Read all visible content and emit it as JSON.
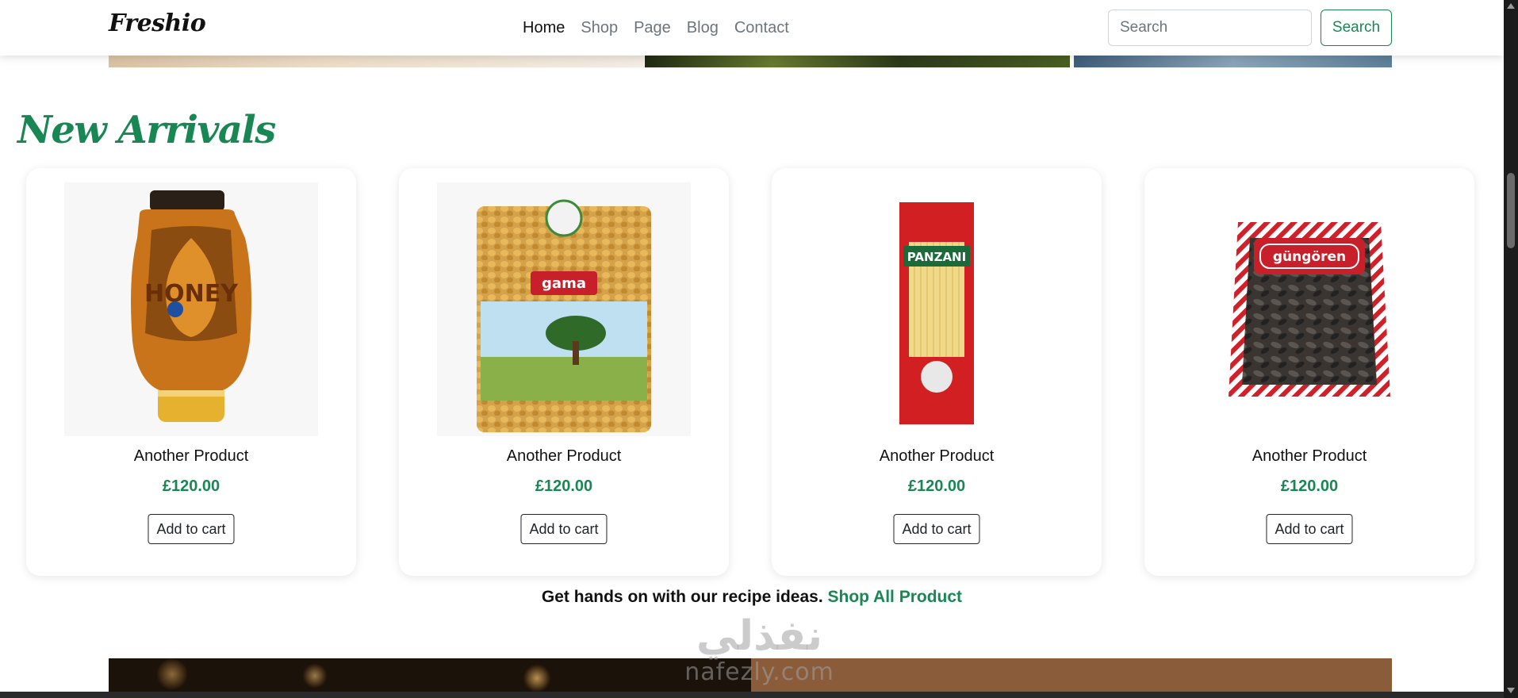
{
  "navbar": {
    "brand": "Freshio",
    "links": [
      {
        "label": "Home",
        "active": true
      },
      {
        "label": "Shop",
        "active": false
      },
      {
        "label": "Page",
        "active": false
      },
      {
        "label": "Blog",
        "active": false
      },
      {
        "label": "Contact",
        "active": false
      }
    ],
    "search_placeholder": "Search",
    "search_button": "Search"
  },
  "section": {
    "title": "New Arrivals"
  },
  "products": [
    {
      "name": "Another Product",
      "price": "£120.00",
      "button": "Add to cart",
      "image": "honey-bottle",
      "image_text": "HONEY"
    },
    {
      "name": "Another Product",
      "price": "£120.00",
      "button": "Add to cart",
      "image": "popping-corn-bag",
      "image_text": "gama"
    },
    {
      "name": "Another Product",
      "price": "£120.00",
      "button": "Add to cart",
      "image": "capellini-pasta-pack",
      "image_text": "PANZANI"
    },
    {
      "name": "Another Product",
      "price": "£120.00",
      "button": "Add to cart",
      "image": "sunflower-seeds-bag",
      "image_text": "güngören"
    }
  ],
  "cta": {
    "text": "Get hands on with our recipe ideas. ",
    "link": "Shop All Product"
  },
  "watermark": {
    "arabic": "نفذلي",
    "latin": "nafezly.com"
  },
  "colors": {
    "accent": "#198754",
    "text": "#212529",
    "muted": "#6c757d"
  }
}
